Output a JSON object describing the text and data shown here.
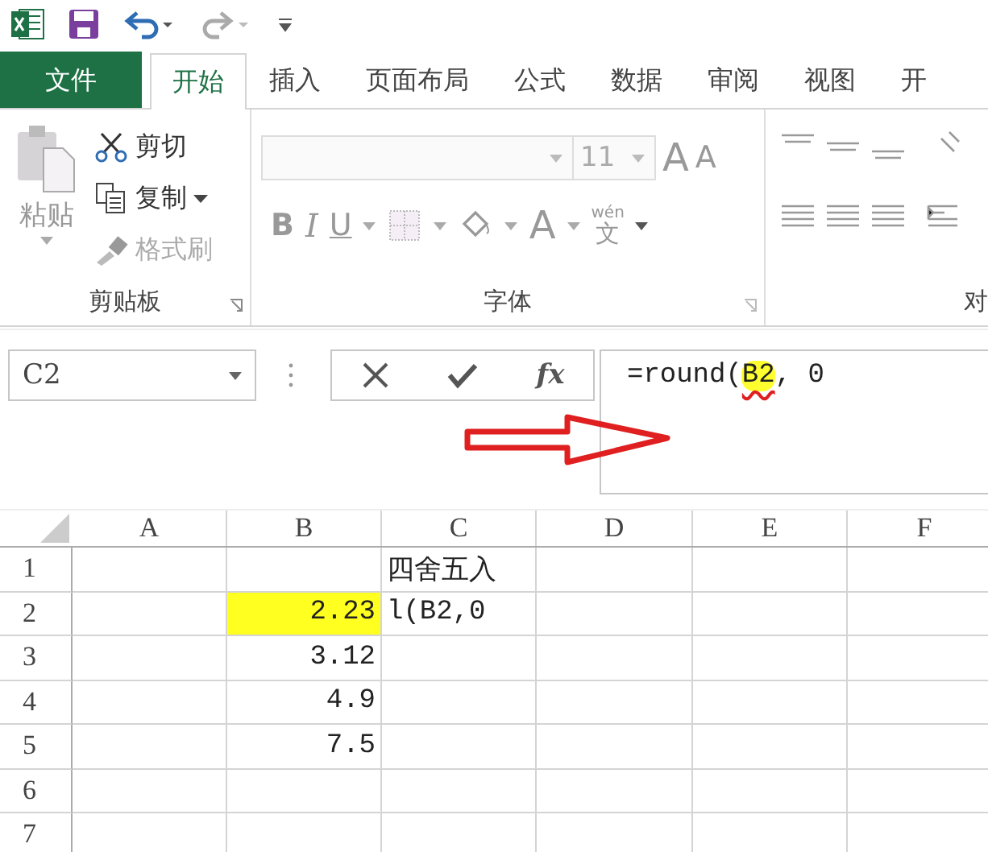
{
  "tabs": [
    {
      "label": "文件",
      "kind": "file",
      "selected": false
    },
    {
      "label": "开始",
      "kind": "tab",
      "selected": true
    },
    {
      "label": "插入",
      "kind": "tab",
      "selected": false
    },
    {
      "label": "页面布局",
      "kind": "tab",
      "selected": false
    },
    {
      "label": "公式",
      "kind": "tab",
      "selected": false
    },
    {
      "label": "数据",
      "kind": "tab",
      "selected": false
    },
    {
      "label": "审阅",
      "kind": "tab",
      "selected": false
    },
    {
      "label": "视图",
      "kind": "tab",
      "selected": false
    },
    {
      "label": "开",
      "kind": "tab",
      "selected": false
    }
  ],
  "clipboard": {
    "paste": "粘贴",
    "cut": "剪切",
    "copy": "复制",
    "format_painter": "格式刷",
    "label": "剪贴板"
  },
  "font": {
    "size": "11",
    "grow": "A",
    "shrink": "A",
    "bold": "B",
    "italic": "I",
    "underline": "U",
    "font_color": "A",
    "phonetic_top": "wén",
    "phonetic_bottom": "文",
    "label": "字体"
  },
  "alignment": {
    "label": "对"
  },
  "formula_bar": {
    "name_box": "C2",
    "fx": "fx",
    "formula": [
      {
        "text": "=round(",
        "highlighted": false,
        "underlined": false
      },
      {
        "text": "B2",
        "highlighted": true,
        "underlined": true
      },
      {
        "text": ", 0",
        "highlighted": false,
        "underlined": false
      }
    ]
  },
  "sheet": {
    "columns": [
      "A",
      "B",
      "C",
      "D",
      "E",
      "F"
    ],
    "rows": [
      {
        "header": "1",
        "cells": [
          "",
          "",
          "四舍五入",
          "",
          "",
          ""
        ],
        "highlighted": [
          false,
          false,
          false,
          false,
          false,
          false
        ]
      },
      {
        "header": "2",
        "cells": [
          "",
          "2.23",
          "l(B2,0",
          "",
          "",
          ""
        ],
        "highlighted": [
          false,
          true,
          false,
          false,
          false,
          false
        ]
      },
      {
        "header": "3",
        "cells": [
          "",
          "3.12",
          "",
          "",
          "",
          ""
        ],
        "highlighted": [
          false,
          false,
          false,
          false,
          false,
          false
        ]
      },
      {
        "header": "4",
        "cells": [
          "",
          "4.9",
          "",
          "",
          "",
          ""
        ],
        "highlighted": [
          false,
          false,
          false,
          false,
          false,
          false
        ]
      },
      {
        "header": "5",
        "cells": [
          "",
          "7.5",
          "",
          "",
          "",
          ""
        ],
        "highlighted": [
          false,
          false,
          false,
          false,
          false,
          false
        ]
      },
      {
        "header": "6",
        "cells": [
          "",
          "",
          "",
          "",
          "",
          ""
        ],
        "highlighted": [
          false,
          false,
          false,
          false,
          false,
          false
        ]
      },
      {
        "header": "7",
        "cells": [
          "",
          "",
          "",
          "",
          "",
          ""
        ],
        "highlighted": [
          false,
          false,
          false,
          false,
          false,
          false
        ]
      }
    ]
  }
}
